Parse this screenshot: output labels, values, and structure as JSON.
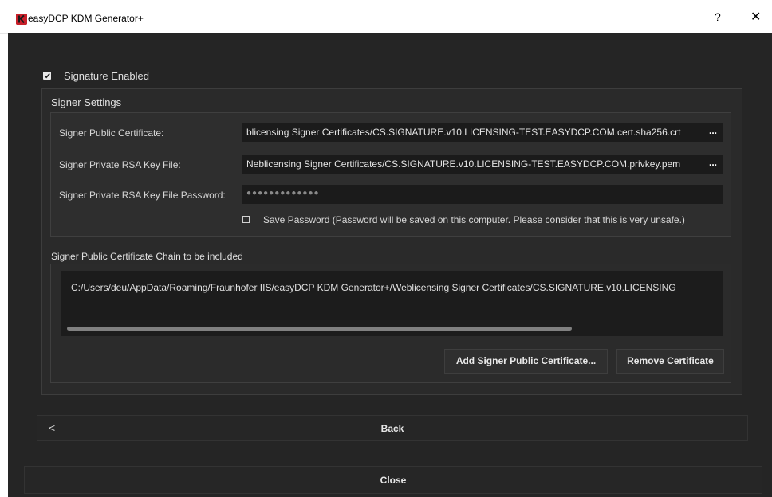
{
  "window": {
    "title": "easyDCP KDM Generator+",
    "help_label": "?",
    "close_label": "✕",
    "icon_letter": "K"
  },
  "signature": {
    "enabled_label": "Signature Enabled",
    "enabled": true
  },
  "signer_settings": {
    "title": "Signer Settings",
    "public_cert_label": "Signer Public Certificate:",
    "public_cert_value": "blicensing Signer Certificates/CS.SIGNATURE.v10.LICENSING-TEST.EASYDCP.COM.cert.sha256.crt",
    "private_key_label": "Signer Private RSA Key File:",
    "private_key_value": "Neblicensing Signer Certificates/CS.SIGNATURE.v10.LICENSING-TEST.EASYDCP.COM.privkey.pem",
    "password_label": "Signer Private RSA Key File Password:",
    "password_mask": "●●●●●●●●●●●●●",
    "browse_label": "...",
    "save_password_label": "Save Password (Password will be saved on this computer. Please consider that this is very unsafe.)",
    "save_password_checked": false
  },
  "chain": {
    "title": "Signer Public Certificate Chain to be included",
    "items": [
      "C:/Users/deu/AppData/Roaming/Fraunhofer IIS/easyDCP KDM Generator+/Weblicensing Signer Certificates/CS.SIGNATURE.v10.LICENSING"
    ],
    "add_button": "Add Signer Public Certificate...",
    "remove_button": "Remove Certificate"
  },
  "nav": {
    "back_chevron": "<",
    "back_label": "Back",
    "close_label": "Close"
  },
  "colors": {
    "background": "#252525",
    "field": "#1b1b1b",
    "icon_red": "#c8202a"
  }
}
